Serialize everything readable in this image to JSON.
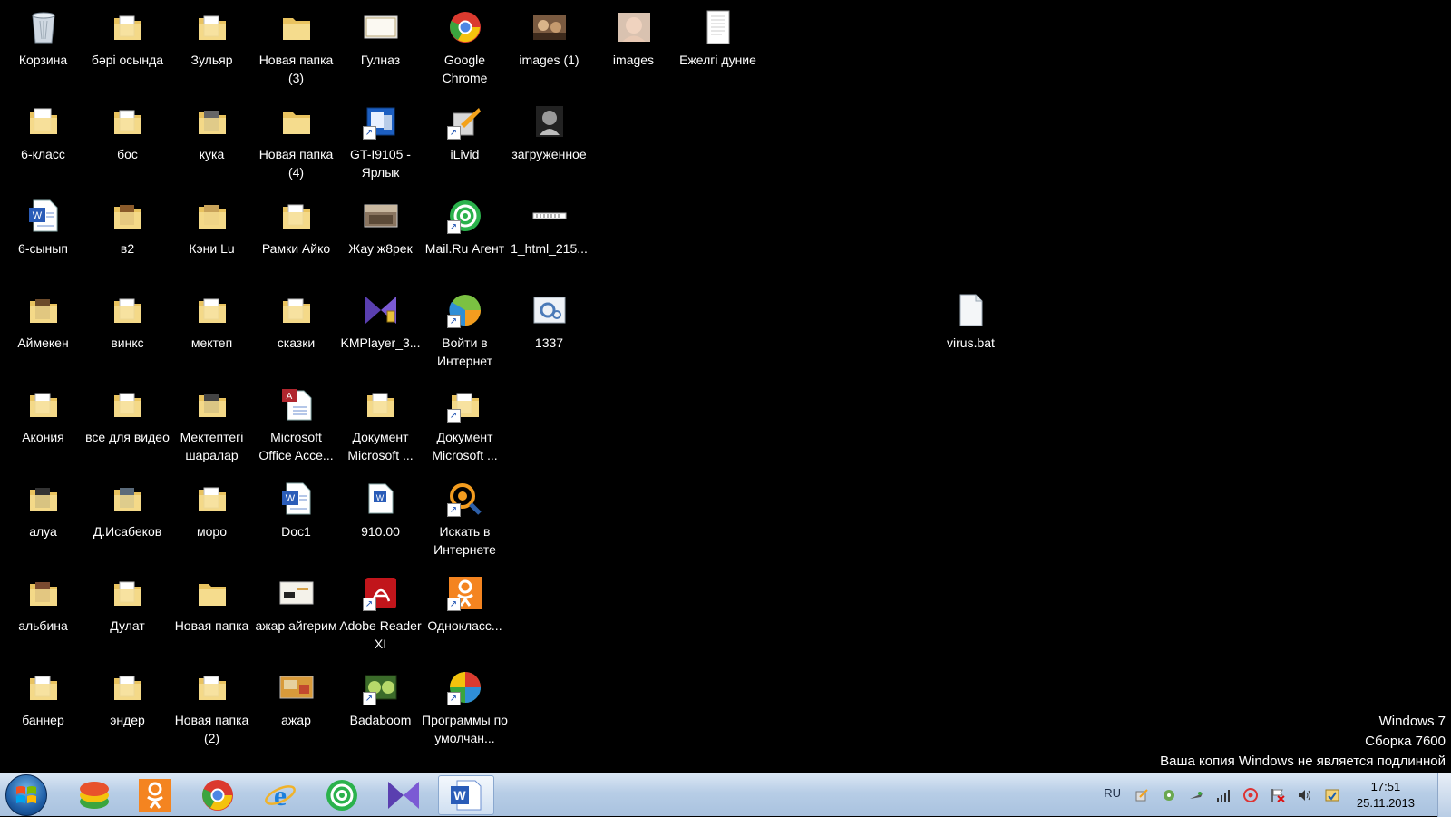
{
  "desktop": {
    "icons": [
      {
        "label": "Корзина",
        "type": "recycle-bin"
      },
      {
        "label": "6-класс",
        "type": "folder"
      },
      {
        "label": "6-сынып",
        "type": "word-doc"
      },
      {
        "label": "Аймекен",
        "type": "folder"
      },
      {
        "label": "Акония",
        "type": "folder"
      },
      {
        "label": "алуа",
        "type": "folder"
      },
      {
        "label": "альбина",
        "type": "folder"
      },
      {
        "label": "баннер",
        "type": "folder"
      },
      {
        "label": "бәрі осында",
        "type": "folder"
      },
      {
        "label": "бос",
        "type": "folder"
      },
      {
        "label": "в2",
        "type": "folder"
      },
      {
        "label": "винкс",
        "type": "folder"
      },
      {
        "label": "все для видео",
        "type": "folder"
      },
      {
        "label": "Д.Исабеков",
        "type": "folder"
      },
      {
        "label": "Дулат",
        "type": "folder"
      },
      {
        "label": "эндер",
        "type": "folder"
      },
      {
        "label": "Зульяр",
        "type": "folder"
      },
      {
        "label": "кука",
        "type": "folder"
      },
      {
        "label": "Кэни Lu",
        "type": "folder"
      },
      {
        "label": "мектеп",
        "type": "folder"
      },
      {
        "label": "Мектептегі шаралар",
        "type": "folder"
      },
      {
        "label": "моро",
        "type": "folder"
      },
      {
        "label": "Новая папка",
        "type": "folder"
      },
      {
        "label": "Новая папка (2)",
        "type": "folder"
      },
      {
        "label": "Новая папка (3)",
        "type": "folder"
      },
      {
        "label": "Новая папка (4)",
        "type": "folder"
      },
      {
        "label": "Рамки Айко",
        "type": "folder"
      },
      {
        "label": "сказки",
        "type": "folder"
      },
      {
        "label": "Microsoft Office Acce...",
        "type": "access"
      },
      {
        "label": "Doc1",
        "type": "word-doc"
      },
      {
        "label": "ажар айгерим",
        "type": "image"
      },
      {
        "label": "ажар",
        "type": "image"
      },
      {
        "label": "Гулназ",
        "type": "image"
      },
      {
        "label": "GT-I9105 - Ярлык",
        "type": "app-shortcut"
      },
      {
        "label": "Жау ж8рек",
        "type": "image"
      },
      {
        "label": "KMPlayer_3...",
        "type": "kmplayer"
      },
      {
        "label": "Документ Microsoft ...",
        "type": "folder-doc"
      },
      {
        "label": "910.00",
        "type": "word-doc"
      },
      {
        "label": "Adobe Reader XI",
        "type": "adobe"
      },
      {
        "label": "Badaboom",
        "type": "badaboom"
      },
      {
        "label": "Google Chrome",
        "type": "chrome"
      },
      {
        "label": "iLivid",
        "type": "ilivid"
      },
      {
        "label": "Mail.Ru Агент",
        "type": "mailru"
      },
      {
        "label": "Войти в Интернет",
        "type": "internet"
      },
      {
        "label": "Документ Microsoft ...",
        "type": "folder-doc"
      },
      {
        "label": "Искать в Интернете",
        "type": "search-web"
      },
      {
        "label": "Однокласс...",
        "type": "odnoklassniki"
      },
      {
        "label": "Программы по умолчан...",
        "type": "default-programs"
      },
      {
        "label": "images (1)",
        "type": "photo"
      },
      {
        "label": "загруженное",
        "type": "photo-bw"
      },
      {
        "label": "1_html_215...",
        "type": "html-strip"
      },
      {
        "label": "1337",
        "type": "settings-file"
      },
      {
        "label": "images",
        "type": "photo-baby"
      },
      {
        "label": "Ежелгі дуние",
        "type": "text-doc"
      },
      {
        "label": "virus.bat",
        "type": "bat-file"
      }
    ]
  },
  "watermark": {
    "line1": "Windows 7",
    "line2": "Сборка 7600",
    "line3": "Ваша копия Windows не является подлинной"
  },
  "taskbar": {
    "start": "start-orb-icon",
    "pinned": [
      "bluestacks-icon",
      "odnoklassniki-icon",
      "chrome-icon",
      "internet-explorer-icon",
      "mailru-agent-icon",
      "kmplayer-icon",
      "word-icon"
    ],
    "language": "RU",
    "time": "17:51",
    "date": "25.11.2013",
    "tray_icons": [
      "ilivid-tray-icon",
      "torrent-tray-icon",
      "network-tray-icon",
      "signal-tray-icon",
      "mail-tray-icon",
      "action-center-flag-icon",
      "volume-icon",
      "update-tray-icon"
    ]
  },
  "colors": {
    "desktop": "#000000",
    "folder": "#f2d27a",
    "taskbar": "#b9cfe7"
  }
}
